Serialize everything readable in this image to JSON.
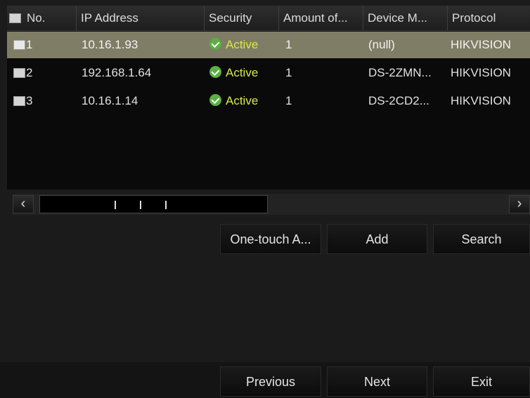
{
  "table": {
    "columns": [
      "No.",
      "IP Address",
      "Security",
      "Amount of...",
      "Device M...",
      "Protocol"
    ],
    "rows": [
      {
        "no": "1",
        "ip": "10.16.1.93",
        "security": "Active",
        "amount": "1",
        "device_model": "(null)",
        "protocol": "HIKVISION",
        "selected": true
      },
      {
        "no": "2",
        "ip": "192.168.1.64",
        "security": "Active",
        "amount": "1",
        "device_model": "DS-2ZMN...",
        "protocol": "HIKVISION",
        "selected": false
      },
      {
        "no": "3",
        "ip": "10.16.1.14",
        "security": "Active",
        "amount": "1",
        "device_model": "DS-2CD2...",
        "protocol": "HIKVISION",
        "selected": false
      }
    ]
  },
  "scrollbar": {
    "left_arrow": "‹",
    "right_arrow": "›"
  },
  "actions": {
    "one_touch": "One-touch A...",
    "add": "Add",
    "search": "Search"
  },
  "footer": {
    "previous": "Previous",
    "next": "Next",
    "exit": "Exit"
  },
  "colors": {
    "selected_row": "#807d66",
    "active_text": "#d9e84a",
    "check_badge": "#5bb043"
  },
  "icons": {
    "security_status": "check-circle-icon"
  }
}
